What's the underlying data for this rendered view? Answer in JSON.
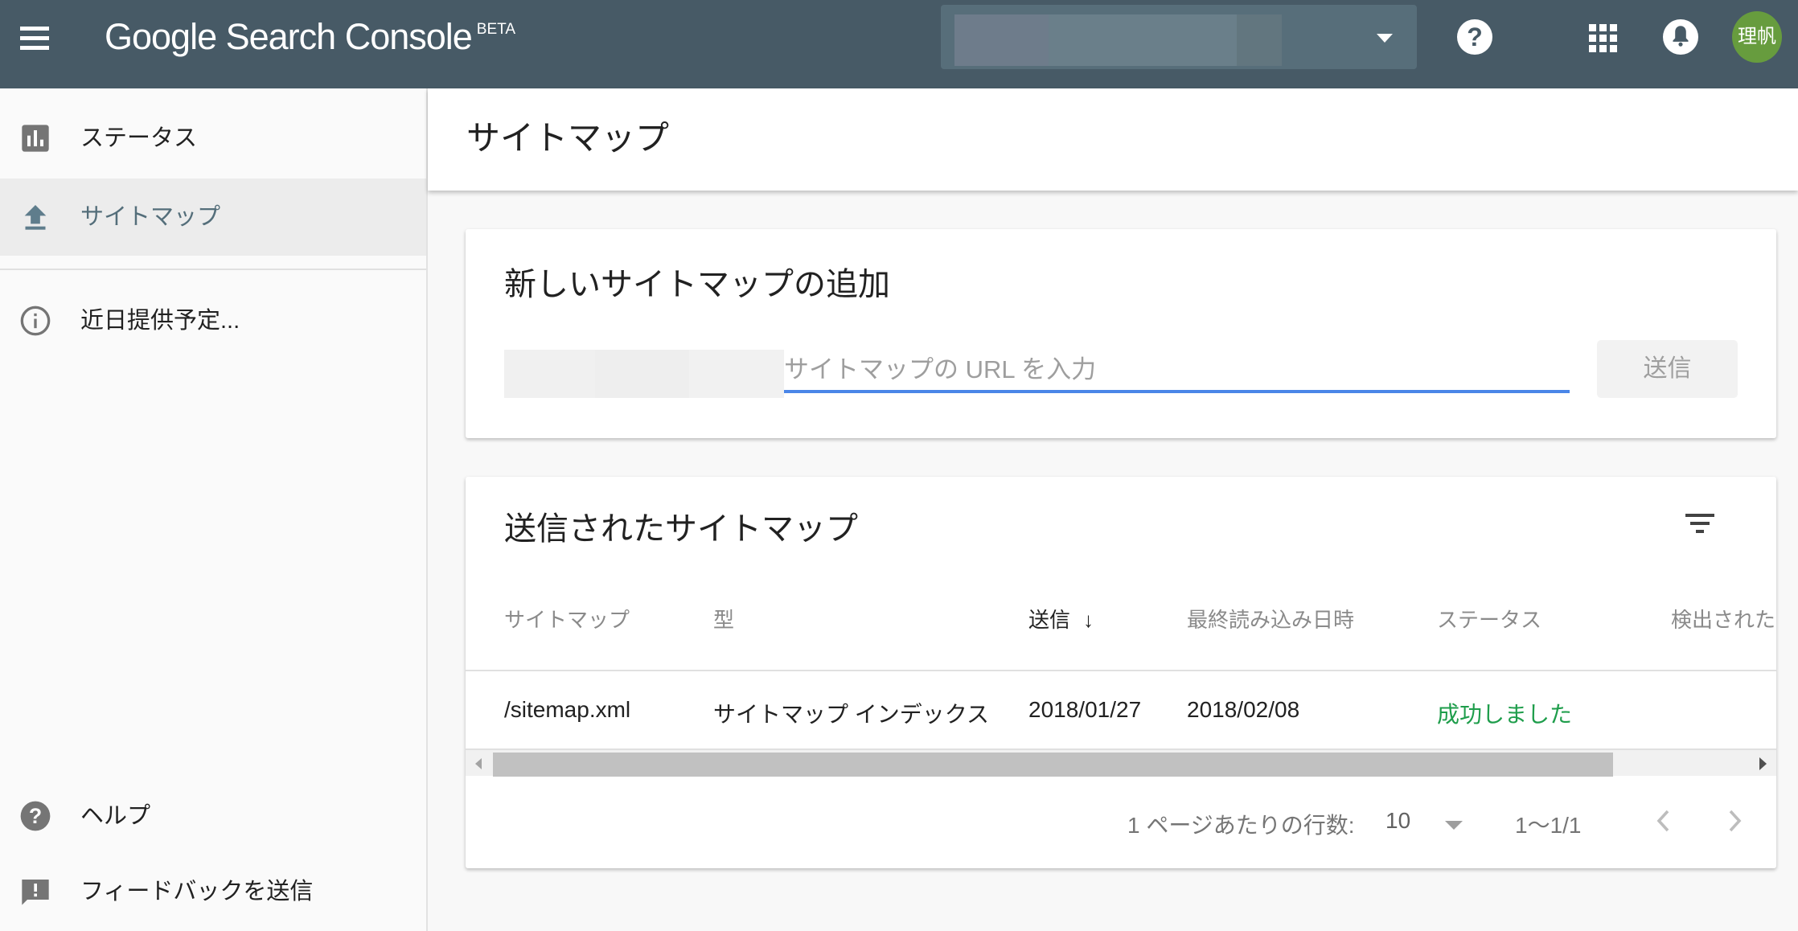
{
  "header": {
    "brand": "Google Search Console",
    "brand_badge": "BETA",
    "property_selector": {
      "value": "",
      "redacted": true
    },
    "avatar_text": "理帆"
  },
  "sidebar": {
    "items": [
      {
        "label": "ステータス",
        "icon": "bar-chart-icon",
        "active": false
      },
      {
        "label": "サイトマップ",
        "icon": "upload-icon",
        "active": true
      },
      {
        "label": "近日提供予定...",
        "icon": "info-icon",
        "active": false
      }
    ],
    "bottom_items": [
      {
        "label": "ヘルプ",
        "icon": "help-icon"
      },
      {
        "label": "フィードバックを送信",
        "icon": "feedback-icon"
      }
    ]
  },
  "page": {
    "title": "サイトマップ"
  },
  "add_sitemap": {
    "title": "新しいサイトマップの追加",
    "url_prefix": "",
    "input_value": "",
    "input_placeholder": "サイトマップの URL を入力",
    "submit_label": "送信"
  },
  "submitted_sitemaps": {
    "title": "送信されたサイトマップ",
    "columns": [
      {
        "label": "サイトマップ",
        "sorted": false
      },
      {
        "label": "型",
        "sorted": false
      },
      {
        "label": "送信",
        "sorted": true,
        "sort_direction": "desc"
      },
      {
        "label": "最終読み込み日時",
        "sorted": false
      },
      {
        "label": "ステータス",
        "sorted": false
      },
      {
        "label": "検出された",
        "sorted": false
      }
    ],
    "rows": [
      {
        "sitemap": "/sitemap.xml",
        "type": "サイトマップ インデックス",
        "submitted": "2018/01/27",
        "last_read": "2018/02/08",
        "status": "成功しました",
        "discovered": ""
      }
    ],
    "pagination": {
      "rows_per_page_label": "1 ページあたりの行数:",
      "rows_per_page": "10",
      "range": "1～1/1"
    },
    "status_color": "#1e9d4b"
  },
  "colors": {
    "header_bg": "#475a66",
    "accent_blue": "#4a86e8",
    "avatar_bg": "#679c3e"
  }
}
